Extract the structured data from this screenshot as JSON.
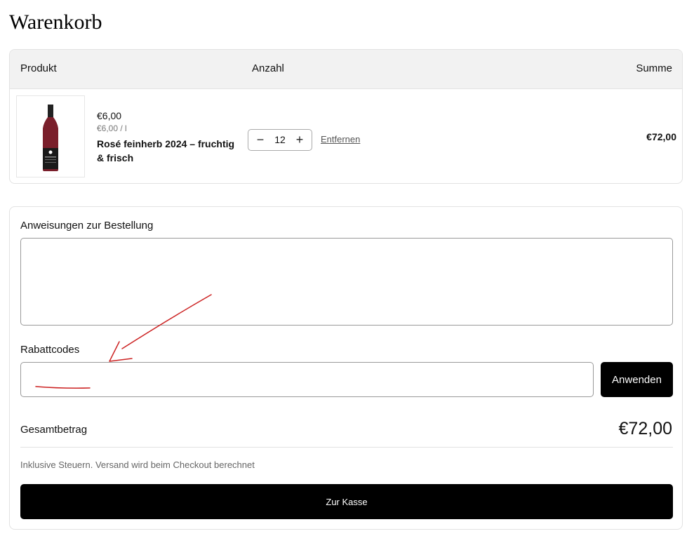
{
  "page": {
    "title": "Warenkorb"
  },
  "cart": {
    "headers": {
      "product": "Produkt",
      "quantity": "Anzahl",
      "total": "Summe"
    },
    "items": [
      {
        "price": "€6,00",
        "unit_price": "€6,00 / l",
        "name": "Rosé feinherb 2024 – fruchtig & frisch",
        "quantity": "12",
        "remove_label": "Entfernen",
        "line_total": "€72,00",
        "image_icon": "wine-bottle-icon"
      }
    ],
    "quantity_controls": {
      "decrease_symbol": "−",
      "increase_symbol": "+"
    }
  },
  "order": {
    "notes_label": "Anweisungen zur Bestellung",
    "notes_value": "",
    "discount_label": "Rabattcodes",
    "discount_value": "",
    "apply_label": "Anwenden",
    "total_label": "Gesamtbetrag",
    "total_value": "€72,00",
    "tax_note": "Inklusive Steuern. Versand wird beim Checkout berechnet",
    "checkout_label": "Zur Kasse"
  },
  "colors": {
    "button_bg": "#000000",
    "annotation": "#cc2222",
    "header_bg": "#f2f2f2",
    "wine": "#7a1f2b"
  }
}
